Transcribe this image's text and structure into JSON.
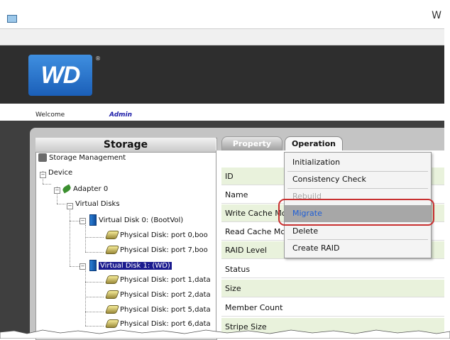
{
  "window": {
    "title_fragment": "W"
  },
  "header": {
    "logo_text": "WD",
    "logo_mark": "®"
  },
  "welcome": {
    "label": "Welcome",
    "user": "Admin"
  },
  "storage_panel": {
    "title": "Storage",
    "tree": [
      {
        "id": "storage-management",
        "label": "Storage Management",
        "icon": "storage-management-icon"
      },
      {
        "id": "device",
        "label": "Device",
        "expander": "−"
      },
      {
        "id": "adapter-0",
        "label": "Adapter 0",
        "expander": "−",
        "icon": "adapter-leaf-icon"
      },
      {
        "id": "virtual-disks",
        "label": "Virtual Disks",
        "expander": "−"
      },
      {
        "id": "vd0",
        "label": "Virtual Disk 0: (BootVol)",
        "expander": "−",
        "icon": "virtual-disk-icon"
      },
      {
        "id": "vd0-pd0",
        "label": "Physical Disk: port 0,boo",
        "icon": "physical-disk-icon"
      },
      {
        "id": "vd0-pd7",
        "label": "Physical Disk: port 7,boo",
        "icon": "physical-disk-icon"
      },
      {
        "id": "vd1",
        "label": "Virtual Disk 1: (WD)",
        "expander": "−",
        "icon": "virtual-disk-icon",
        "selected": true
      },
      {
        "id": "vd1-pd1",
        "label": "Physical Disk: port 1,data",
        "icon": "physical-disk-icon"
      },
      {
        "id": "vd1-pd2",
        "label": "Physical Disk: port 2,data",
        "icon": "physical-disk-icon"
      },
      {
        "id": "vd1-pd5",
        "label": "Physical Disk: port 5,data",
        "icon": "physical-disk-icon"
      },
      {
        "id": "vd1-pd6",
        "label": "Physical Disk: port 6,data",
        "icon": "physical-disk-icon"
      }
    ]
  },
  "tabs": {
    "property": "Property",
    "operation": "Operation"
  },
  "properties": [
    {
      "label": "ID"
    },
    {
      "label": "Name"
    },
    {
      "label": "Write Cache Mc"
    },
    {
      "label": "Read Cache Mc"
    },
    {
      "label": "RAID Level"
    },
    {
      "label": "Status"
    },
    {
      "label": "Size"
    },
    {
      "label": "Member Count"
    },
    {
      "label": "Stripe Size"
    }
  ],
  "operation_menu": {
    "items": [
      {
        "label": "Initialization",
        "state": "normal"
      },
      {
        "label": "Consistency Check",
        "state": "normal"
      },
      {
        "label": "Rebuild",
        "state": "disabled"
      },
      {
        "label": "Migrate",
        "state": "highlighted"
      },
      {
        "label": "Delete",
        "state": "normal"
      },
      {
        "label": "Create RAID",
        "state": "normal"
      }
    ]
  },
  "colors": {
    "header_bg": "#2e2e2e",
    "selected_bg": "#1a1a8e",
    "highlight_text": "#1e5ed6",
    "callout": "#c83030",
    "property_row_alt": "#e9f2dc"
  }
}
